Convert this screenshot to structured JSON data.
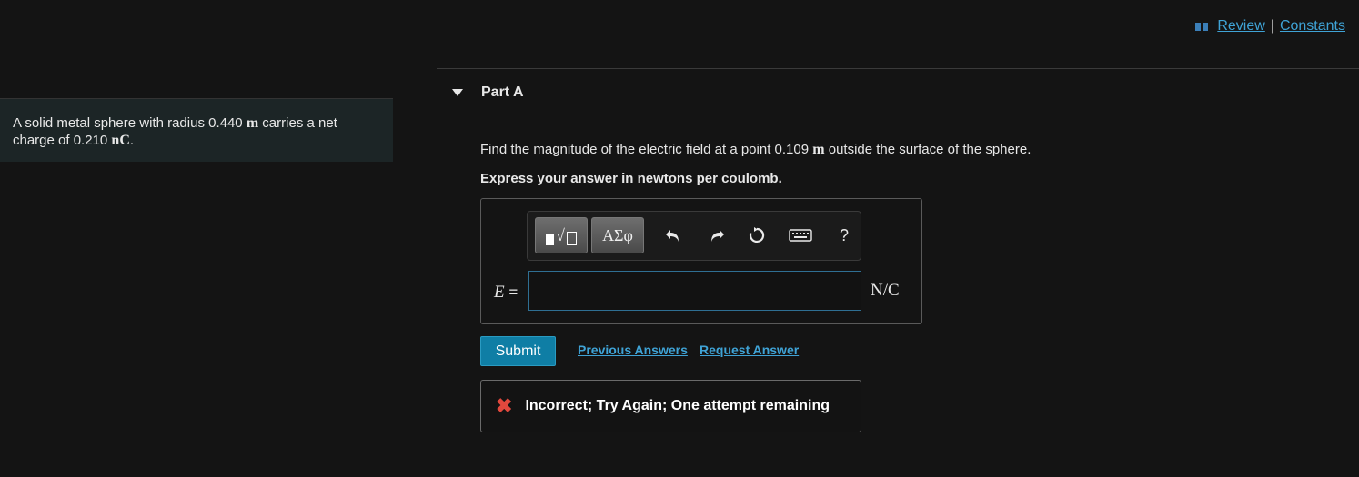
{
  "problem": {
    "text_a": "A solid metal sphere with radius 0.440 ",
    "unit_a": "m",
    "text_b": " carries a net charge of 0.210 ",
    "unit_b": "nC",
    "text_c": "."
  },
  "header": {
    "review_label": "Review",
    "separator": "|",
    "constants_label": "Constants"
  },
  "part": {
    "title": "Part A",
    "question_a": "Find the magnitude of the electric field at a point 0.109 ",
    "question_unit": "m",
    "question_b": " outside the surface of the sphere.",
    "instruction": "Express your answer in newtons per coulomb."
  },
  "toolbar": {
    "greek_label": "ΑΣφ",
    "help_label": "?",
    "icons": [
      "templates-icon",
      "greek-symbols-icon",
      "undo-icon",
      "redo-icon",
      "reset-icon",
      "keyboard-icon",
      "help-icon"
    ]
  },
  "answer": {
    "variable": "E",
    "equals": "=",
    "value": "",
    "unit": "N/C"
  },
  "actions": {
    "submit_label": "Submit",
    "previous_answers_label": "Previous Answers",
    "request_answer_label": "Request Answer"
  },
  "feedback": {
    "text": "Incorrect; Try Again; One attempt remaining",
    "color": "#e2483d"
  },
  "colors": {
    "accent": "#3fa3d6",
    "submit": "#0f7ea5",
    "background": "#141414"
  }
}
